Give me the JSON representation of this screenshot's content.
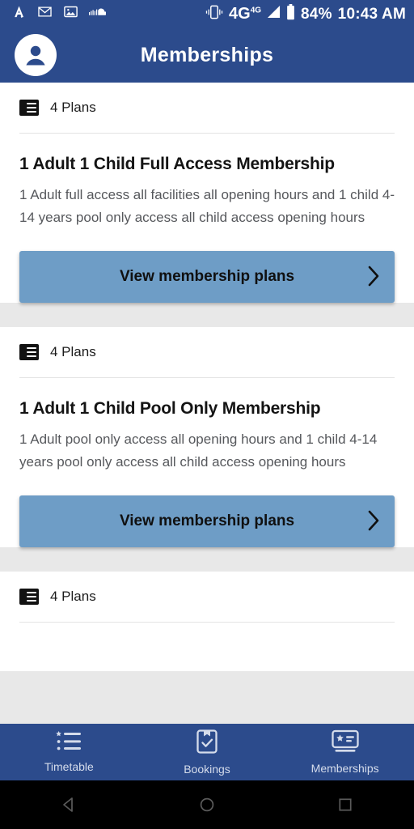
{
  "status_bar": {
    "left_icons": [
      "adobe-acrobat-icon",
      "gmail-icon",
      "photos-icon",
      "soundcloud-icon"
    ],
    "vibrate_icon": "vibrate-icon",
    "network": "4G",
    "network_sup": "4G",
    "battery_percent": "84%",
    "time": "10:43 AM"
  },
  "header": {
    "title": "Memberships",
    "avatar_icon": "account-avatar-icon"
  },
  "colors": {
    "brand_blue": "#2c4b8c",
    "button_blue": "#6e9dc6",
    "page_bg": "#e8e8e8",
    "card_bg": "#ffffff",
    "body_text": "#56585c"
  },
  "cards": [
    {
      "plans_count": "4 Plans",
      "title": "1 Adult 1 Child Full Access Membership",
      "description": "1 Adult full access all facilities all opening hours and 1 child 4-14 years pool only access all child access opening hours",
      "cta_label": "View membership plans"
    },
    {
      "plans_count": "4 Plans",
      "title": "1 Adult 1 Child Pool Only Membership",
      "description": "1 Adult pool only access all opening hours and 1 child 4-14 years pool only access all child access opening hours",
      "cta_label": "View membership plans"
    },
    {
      "plans_count": "4 Plans"
    }
  ],
  "bottom_nav": {
    "items": [
      {
        "label": "Timetable",
        "icon": "list-star-icon"
      },
      {
        "label": "Bookings",
        "icon": "clipboard-check-icon"
      },
      {
        "label": "Memberships",
        "icon": "membership-card-icon"
      }
    ]
  },
  "system_nav": {
    "back": "back-triangle-icon",
    "home": "home-circle-icon",
    "recents": "recents-square-icon"
  }
}
